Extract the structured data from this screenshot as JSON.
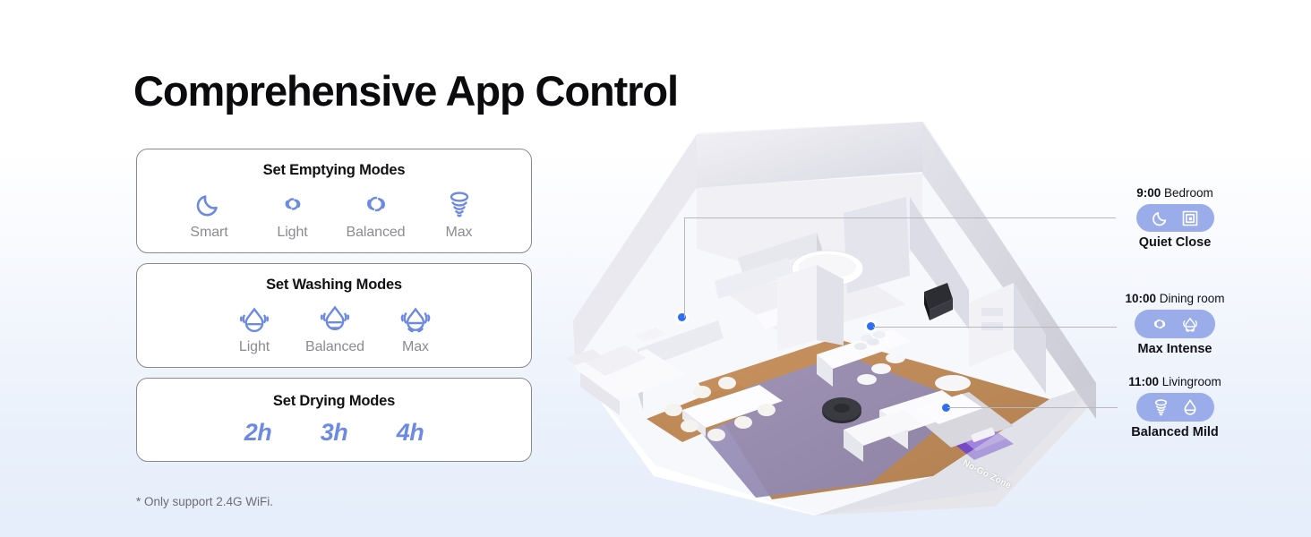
{
  "page": {
    "title": "Comprehensive App Control",
    "footnote": "* Only support 2.4G WiFi.",
    "accent_color": "#6d8ae2",
    "pill_color": "#9aace9",
    "background_top": "#ffffff",
    "background_bottom": "#e6eefb"
  },
  "cards": [
    {
      "id": "card-emptying",
      "title": "Set Emptying Modes",
      "modes": [
        {
          "label": "Smart",
          "icon": "moon-icon"
        },
        {
          "label": "Light",
          "icon": "swirl-small-icon"
        },
        {
          "label": "Balanced",
          "icon": "swirl-large-icon"
        },
        {
          "label": "Max",
          "icon": "tornado-icon"
        }
      ]
    },
    {
      "id": "card-washing",
      "title": "Set Washing Modes",
      "modes": [
        {
          "label": "Light",
          "icon": "droplet-light-icon"
        },
        {
          "label": "Balanced",
          "icon": "droplet-balanced-icon"
        },
        {
          "label": "Max",
          "icon": "droplet-max-icon"
        }
      ]
    },
    {
      "id": "card-drying",
      "title": "Set Drying Modes",
      "durations": [
        "2h",
        "3h",
        "4h"
      ]
    }
  ],
  "schedules": [
    {
      "time": "9:00",
      "room": "Bedroom",
      "caption": "Quiet Close",
      "icons": [
        "moon-icon",
        "square-spiral-icon"
      ]
    },
    {
      "time": "10:00",
      "room": "Dining room",
      "caption": "Max Intense",
      "icons": [
        "swirl-icon",
        "droplet-max-icon"
      ]
    },
    {
      "time": "11:00",
      "room": "Livingroom",
      "caption": "Balanced Mild",
      "icons": [
        "tornado-icon",
        "droplet-icon"
      ]
    }
  ],
  "floorplan": {
    "nogo_zone_label": "No-Go Zone",
    "marker_color": "#2f6ef2",
    "cleaned_zone_color": "#9890b8"
  }
}
